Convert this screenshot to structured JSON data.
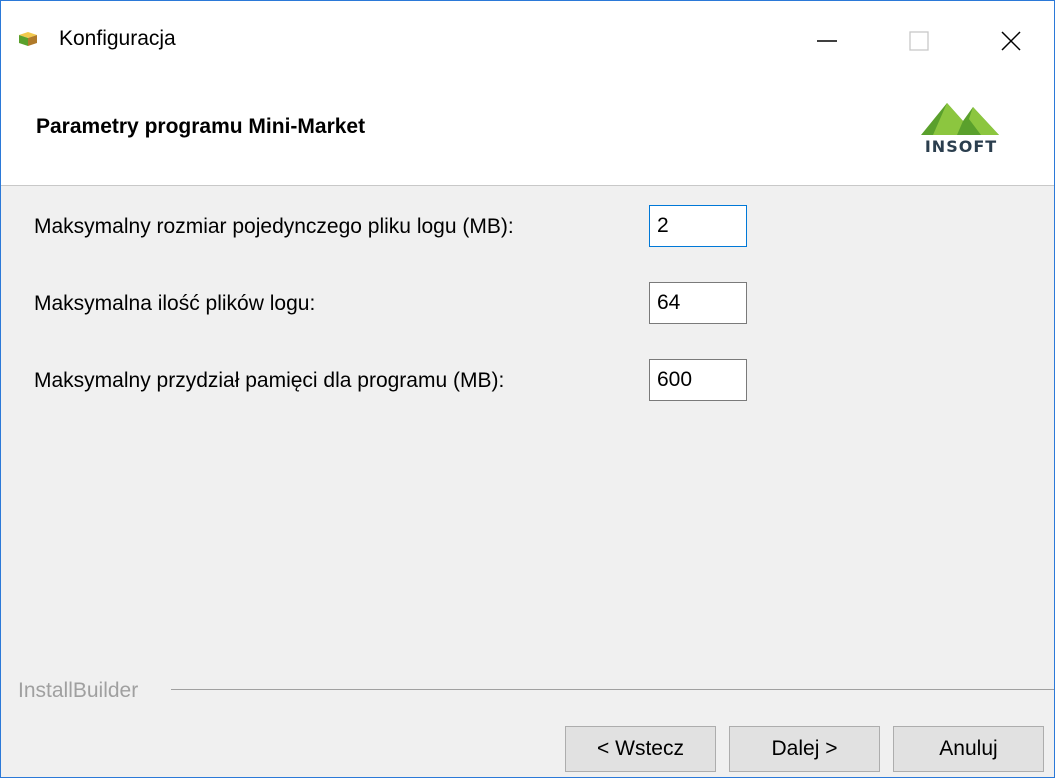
{
  "window": {
    "title": "Konfiguracja",
    "icon": "installer-box-icon"
  },
  "header": {
    "title": "Parametry programu Mini-Market",
    "logo_text": "INSOFT"
  },
  "form": {
    "fields": [
      {
        "label": "Maksymalny rozmiar pojedynczego pliku logu (MB):",
        "value": "2"
      },
      {
        "label": "Maksymalna ilość plików logu:",
        "value": "64"
      },
      {
        "label": "Maksymalny przydział pamięci dla programu (MB):",
        "value": "600"
      }
    ]
  },
  "footer": {
    "group_label": "InstallBuilder",
    "back_label": "< Wstecz",
    "next_label": "Dalej >",
    "cancel_label": "Anuluj"
  },
  "colors": {
    "accent": "#0078d7",
    "logo_green": "#5aa02c",
    "logo_text": "#2b3e4e"
  }
}
